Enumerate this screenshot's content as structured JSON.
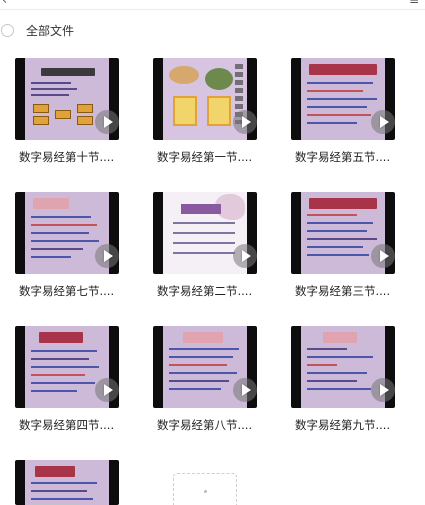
{
  "header": {
    "back_glyph": "‹",
    "partial_text": "",
    "menu_glyph": "≡"
  },
  "select_all": {
    "label": "全部文件"
  },
  "items": [
    {
      "caption": "数字易经第十节...."
    },
    {
      "caption": "数字易经第一节...."
    },
    {
      "caption": "数字易经第五节...."
    },
    {
      "caption": "数字易经第七节...."
    },
    {
      "caption": "数字易经第二节...."
    },
    {
      "caption": "数字易经第三节...."
    },
    {
      "caption": "数字易经第四节...."
    },
    {
      "caption": "数字易经第八节...."
    },
    {
      "caption": "数字易经第九节...."
    },
    {
      "caption": ""
    }
  ],
  "colors": {
    "thumb_bg": "#0d0d0d",
    "slide_purple": "#cdb9d8",
    "title_red": "#a8344a"
  }
}
